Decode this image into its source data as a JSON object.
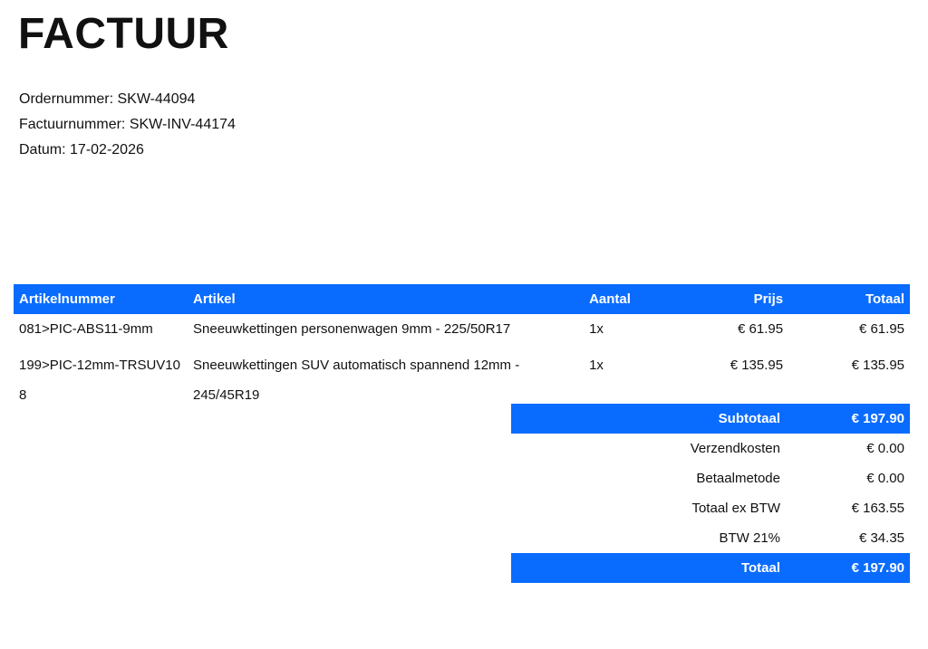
{
  "title": "FACTUUR",
  "meta": {
    "order": "Ordernummer: SKW-44094",
    "invoice": "Factuurnummer: SKW-INV-44174",
    "date": "Datum: 17-02-2026"
  },
  "table": {
    "headers": {
      "sku": "Artikelnummer",
      "article": "Artikel",
      "qty": "Aantal",
      "price": "Prijs",
      "total": "Totaal"
    },
    "rows": [
      {
        "sku": "081>PIC-ABS11-9mm",
        "article": "Sneeuwkettingen personenwagen 9mm - 225/50R17",
        "qty": "1x",
        "price": "€ 61.95",
        "total": "€ 61.95"
      },
      {
        "sku": "199>PIC-12mm-TRSUV108",
        "article": "Sneeuwkettingen SUV automatisch spannend 12mm - 245/45R19",
        "qty": "1x",
        "price": "€ 135.95",
        "total": "€ 135.95"
      }
    ]
  },
  "totals": {
    "subtotal_label": "Subtotaal",
    "subtotal_value": "€ 197.90",
    "shipping_label": "Verzendkosten",
    "shipping_value": "€ 0.00",
    "payment_label": "Betaalmetode",
    "payment_value": "€ 0.00",
    "ex_vat_label": "Totaal ex BTW",
    "ex_vat_value": "€ 163.55",
    "vat_label": "BTW 21%",
    "vat_value": "€ 34.35",
    "total_label": "Totaal",
    "total_value": "€ 197.90"
  },
  "colors": {
    "accent": "#0a6cff",
    "header_text": "#ffffff"
  }
}
